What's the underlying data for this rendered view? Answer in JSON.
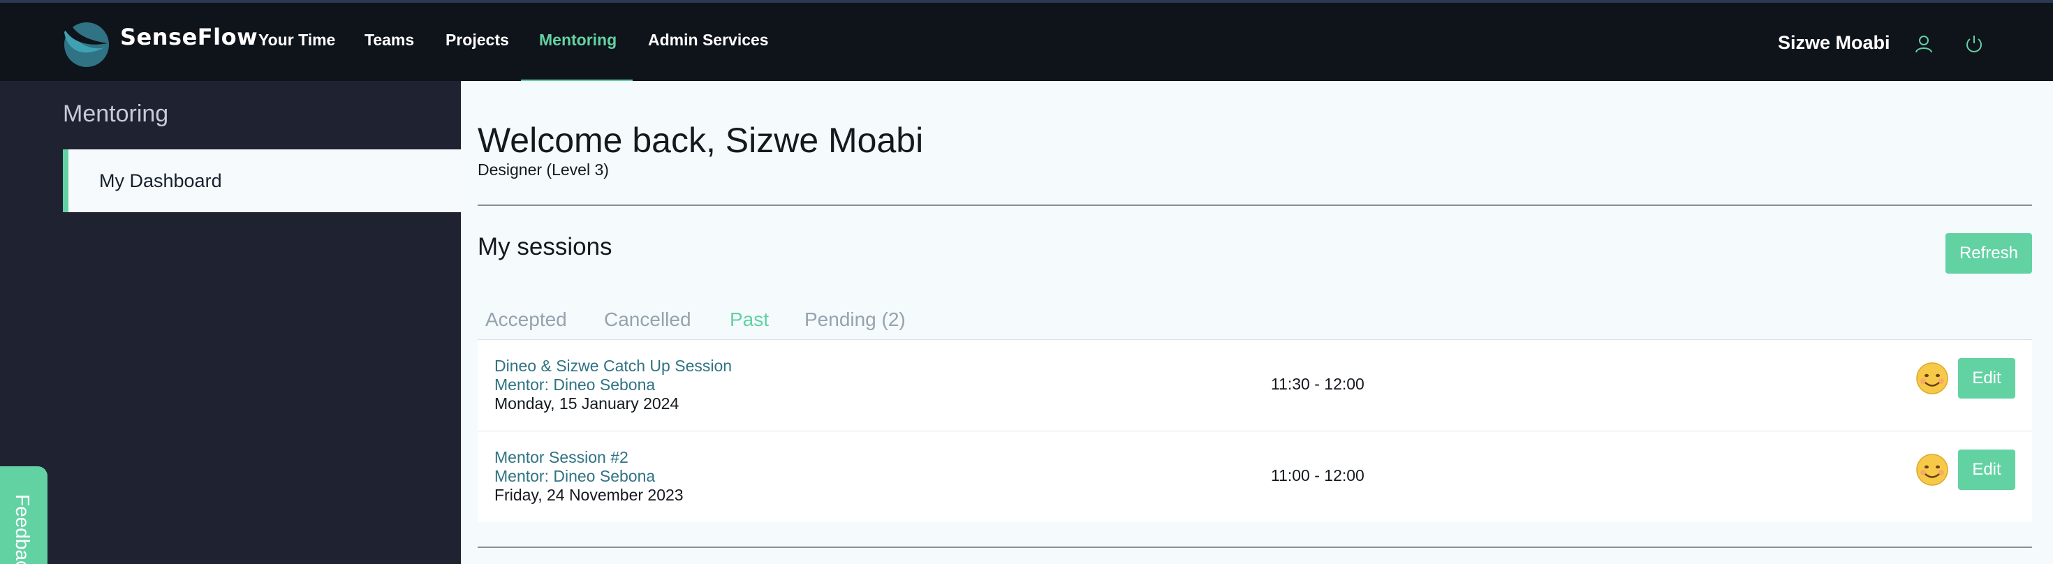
{
  "app": {
    "brand": "SenseFlow"
  },
  "nav": {
    "items": [
      {
        "label": "Your Time"
      },
      {
        "label": "Teams"
      },
      {
        "label": "Projects"
      },
      {
        "label": "Mentoring",
        "active": true
      },
      {
        "label": "Admin Services"
      }
    ]
  },
  "user": {
    "name": "Sizwe Moabi"
  },
  "icons": {
    "logo": "senseflow-logo",
    "profile": "user-icon",
    "power": "power-icon",
    "mood": "smiling-face-emoji"
  },
  "sidebar": {
    "title": "Mentoring",
    "items": [
      {
        "label": "My Dashboard",
        "active": true
      }
    ]
  },
  "feedback": {
    "label": "Feedback"
  },
  "main": {
    "welcome": "Welcome back, Sizwe Moabi",
    "role": "Designer (Level 3)",
    "sessions_title": "My sessions",
    "refresh_label": "Refresh",
    "tabs": [
      {
        "label": "Accepted"
      },
      {
        "label": "Cancelled"
      },
      {
        "label": "Past",
        "active": true
      },
      {
        "label": "Pending (2)"
      }
    ],
    "sessions": [
      {
        "title": "Dineo & Sizwe Catch Up Session",
        "mentor": "Mentor: Dineo Sebona",
        "date": "Monday, 15 January 2024",
        "time": "11:30 - 12:00",
        "edit_label": "Edit"
      },
      {
        "title": "Mentor Session #2",
        "mentor": "Mentor: Dineo Sebona",
        "date": "Friday, 24 November 2023",
        "time": "11:00 - 12:00",
        "edit_label": "Edit"
      }
    ]
  },
  "colors": {
    "accent": "#63d2a3",
    "topbar": "#0f131a",
    "sidebar": "#1f2230",
    "content_bg": "#f5fafd",
    "link": "#2f7384"
  }
}
